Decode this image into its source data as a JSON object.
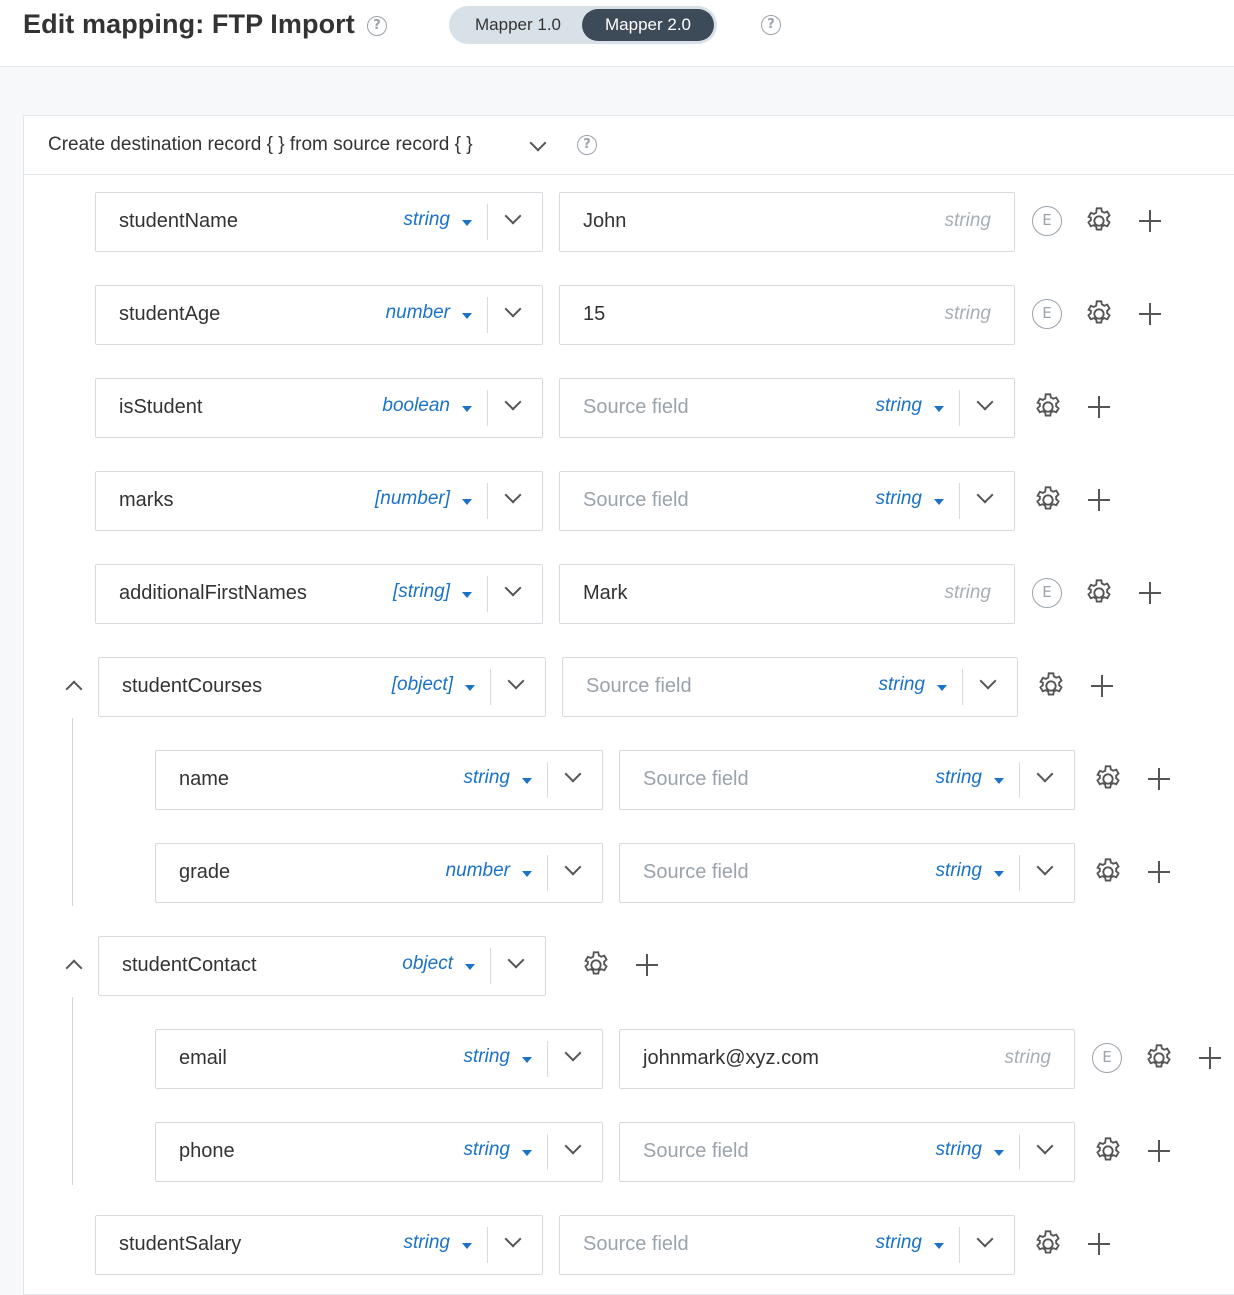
{
  "header": {
    "title": "Edit mapping: FTP Import",
    "help_icon": "question-circle-icon",
    "toggle": {
      "option1": "Mapper 1.0",
      "option2": "Mapper 2.0",
      "selected": "Mapper 2.0"
    }
  },
  "panel": {
    "heading": "Create destination record { } from source record { }"
  },
  "rows": [
    {
      "dest": "studentName",
      "dest_type": "string",
      "source": "John",
      "source_type": "string",
      "source_kind": "hardcoded"
    },
    {
      "dest": "studentAge",
      "dest_type": "number",
      "source": "15",
      "source_type": "string",
      "source_kind": "hardcoded"
    },
    {
      "dest": "isStudent",
      "dest_type": "boolean",
      "source": "Source field",
      "source_type": "string",
      "source_kind": "field"
    },
    {
      "dest": "marks",
      "dest_type": "[number]",
      "source": "Source field",
      "source_type": "string",
      "source_kind": "field"
    },
    {
      "dest": "additionalFirstNames",
      "dest_type": "[string]",
      "source": "Mark",
      "source_type": "string",
      "source_kind": "hardcoded"
    },
    {
      "dest": "studentCourses",
      "dest_type": "[object]",
      "source": "Source field",
      "source_type": "string",
      "source_kind": "field"
    },
    {
      "dest": "name",
      "dest_type": "string",
      "source": "Source field",
      "source_type": "string",
      "source_kind": "field"
    },
    {
      "dest": "grade",
      "dest_type": "number",
      "source": "Source field",
      "source_type": "string",
      "source_kind": "field"
    },
    {
      "dest": "studentContact",
      "dest_type": "object",
      "source": "",
      "source_type": "",
      "source_kind": "none"
    },
    {
      "dest": "email",
      "dest_type": "string",
      "source": "johnmark@xyz.com",
      "source_type": "string",
      "source_kind": "hardcoded"
    },
    {
      "dest": "phone",
      "dest_type": "string",
      "source": "Source field",
      "source_type": "string",
      "source_kind": "field"
    },
    {
      "dest": "studentSalary",
      "dest_type": "string",
      "source": "Source field",
      "source_type": "string",
      "source_kind": "field"
    }
  ],
  "icons": {
    "expression": "E",
    "settings": "gear-icon",
    "add": "plus-icon",
    "collapse": "chevron-up-icon",
    "expand": "chevron-down-icon"
  },
  "colors": {
    "accent": "#1a73c8",
    "toggle_active": "#3d4a57",
    "placeholder": "#9aa3ab"
  }
}
